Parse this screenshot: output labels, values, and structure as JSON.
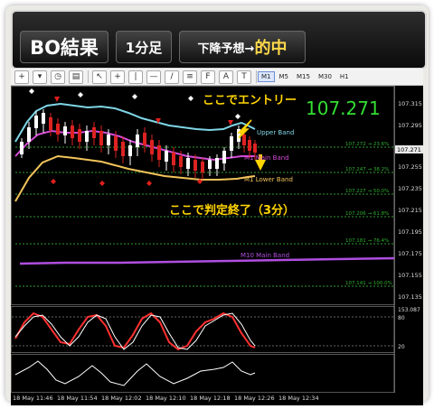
{
  "banner": {
    "result_label": "BO結果",
    "timeframe_label": "1分足",
    "prediction_label": "下降予想→",
    "outcome_label": "的中"
  },
  "toolbar": {
    "timeframes": [
      "M1",
      "M5",
      "M15",
      "M30",
      "H1"
    ],
    "active_timeframe": "M1"
  },
  "chart": {
    "current_price": "107.271",
    "price_ticks": [
      "107.315",
      "107.295",
      "107.275",
      "107.255",
      "107.235",
      "107.215",
      "107.195",
      "107.175",
      "107.155",
      "107.135"
    ],
    "price_badge": "107.271",
    "fib_levels": [
      "107.272 → 23.6%",
      "107.247 → 38.2%",
      "107.227 → 50.0%",
      "107.206 → 61.8%",
      "107.181 → 76.4%",
      "107.141 → 100.0%"
    ],
    "bands": {
      "upper": "Upper Band",
      "main": "M1 Main Band",
      "lower": "M1 Lower Band",
      "m10_main": "M10 Main Band"
    },
    "annotations": {
      "entry": "ここでエントリー",
      "settlement": "ここで判定終了（3分）"
    },
    "indicator_panel_1": {
      "top_label": "153.087",
      "levels": [
        "80",
        "20"
      ]
    },
    "time_labels": [
      "18 May 11:46",
      "18 May 11:54",
      "18 May 12:02",
      "18 May 12:10",
      "18 May 12:18",
      "18 May 12:26",
      "18 May 12:34"
    ]
  },
  "colors": {
    "entry_annotation": "#ffd400",
    "current_price": "#33dd33",
    "upper_band": "#7fd6e6",
    "main_band": "#d54bd6",
    "lower_band": "#f3c45a",
    "m10_band": "#b04ee0",
    "fib_lines": "#2f9e2f",
    "stoch_main": "#ff3030"
  }
}
